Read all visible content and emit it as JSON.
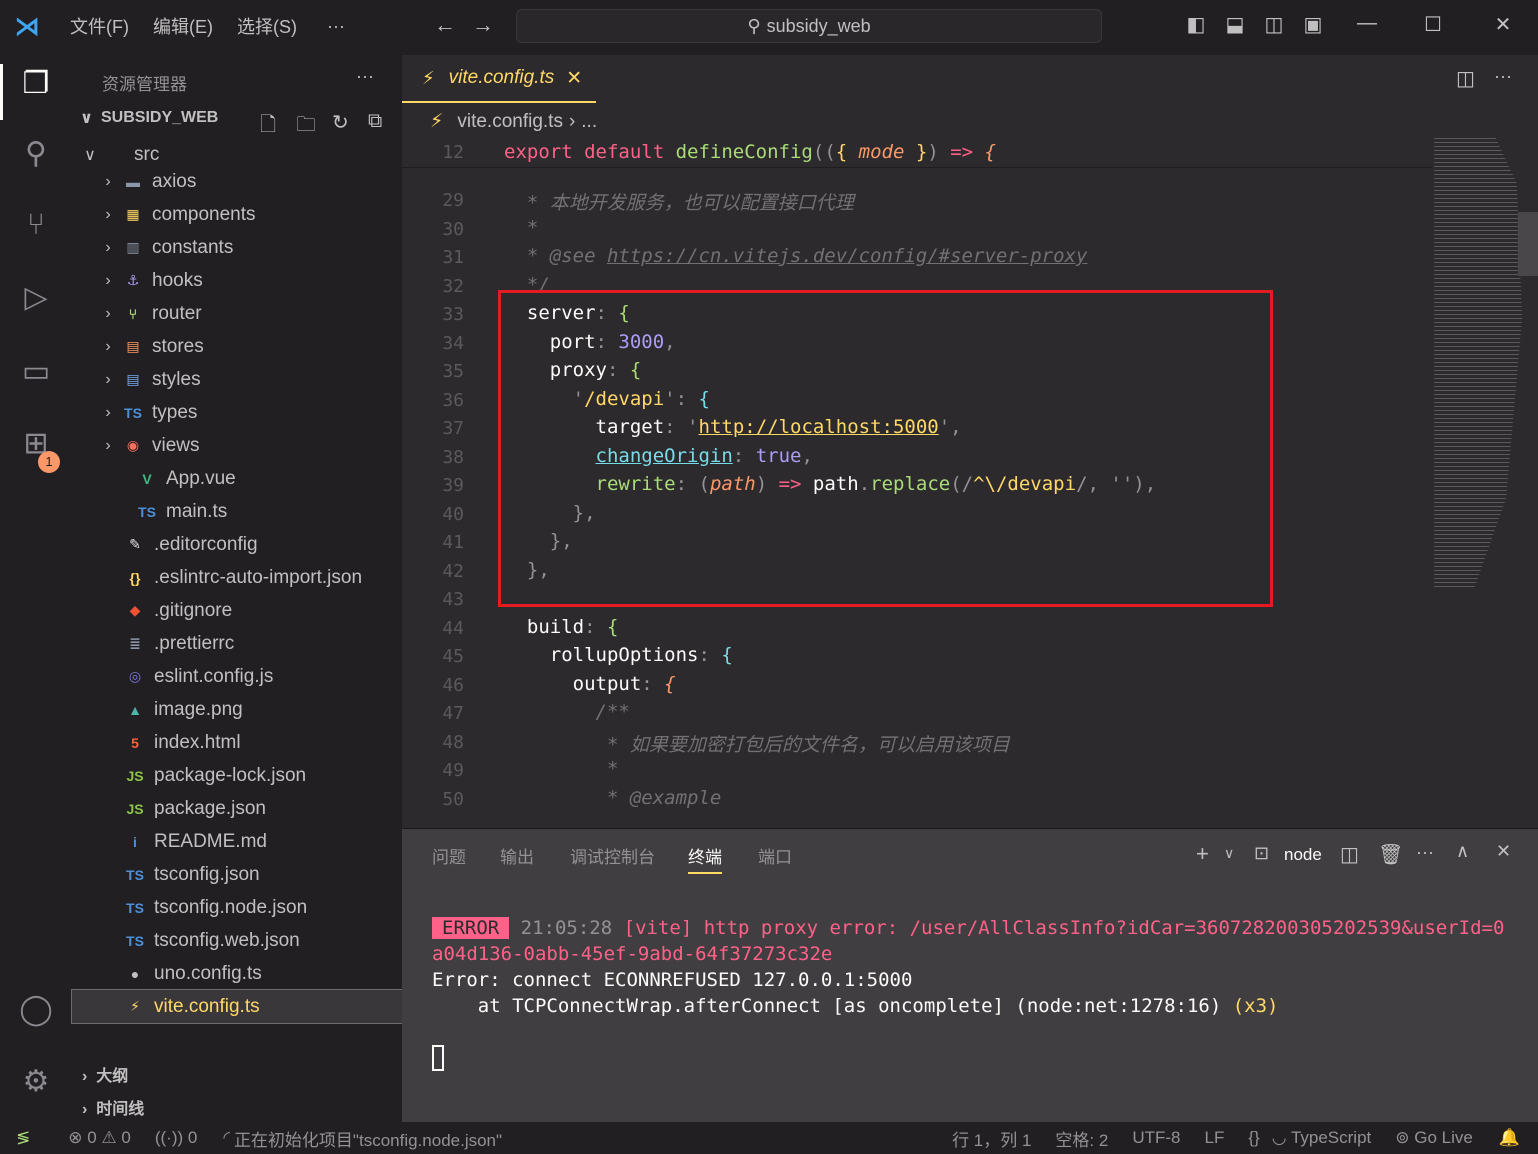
{
  "titlebar": {
    "menus": [
      "文件(F)",
      "编辑(E)",
      "选择(S)",
      "···"
    ],
    "search": "subsidy_web"
  },
  "activity": {
    "badge": "1"
  },
  "sidebar": {
    "title": "资源管理器",
    "more": "···",
    "root": "SUBSIDY_WEB",
    "items": [
      {
        "label": "src",
        "depth": 1,
        "type": "folder-open",
        "icon": "</>",
        "color": "#a9dc76"
      },
      {
        "label": "axios",
        "depth": 2,
        "type": "folder",
        "icon": "▬",
        "color": "#8b96a8"
      },
      {
        "label": "components",
        "depth": 2,
        "type": "folder",
        "icon": "▦",
        "color": "#ffd866"
      },
      {
        "label": "constants",
        "depth": 2,
        "type": "folder",
        "icon": "▥",
        "color": "#8b96a8"
      },
      {
        "label": "hooks",
        "depth": 2,
        "type": "folder",
        "icon": "⚓",
        "color": "#ab9df2"
      },
      {
        "label": "router",
        "depth": 2,
        "type": "folder",
        "icon": "⑂",
        "color": "#a9dc76"
      },
      {
        "label": "stores",
        "depth": 2,
        "type": "folder",
        "icon": "▤",
        "color": "#fc9867"
      },
      {
        "label": "styles",
        "depth": 2,
        "type": "folder",
        "icon": "▤",
        "color": "#78a9e8"
      },
      {
        "label": "types",
        "depth": 2,
        "type": "folder",
        "icon": "TS",
        "color": "#4d8fd8"
      },
      {
        "label": "views",
        "depth": 2,
        "type": "folder",
        "icon": "◉",
        "color": "#fc6d5b"
      },
      {
        "label": "App.vue",
        "depth": 2,
        "type": "file",
        "icon": "V",
        "color": "#41b883"
      },
      {
        "label": "main.ts",
        "depth": 2,
        "type": "file",
        "icon": "TS",
        "color": "#4d8fd8"
      },
      {
        "label": ".editorconfig",
        "depth": 1,
        "type": "file",
        "icon": "✎",
        "color": "#e0e0e0"
      },
      {
        "label": ".eslintrc-auto-import.json",
        "depth": 1,
        "type": "file",
        "icon": "{}",
        "color": "#ffd866"
      },
      {
        "label": ".gitignore",
        "depth": 1,
        "type": "file",
        "icon": "◆",
        "color": "#f05133"
      },
      {
        "label": ".prettierrc",
        "depth": 1,
        "type": "file",
        "icon": "≣",
        "color": "#8b96a8"
      },
      {
        "label": "eslint.config.js",
        "depth": 1,
        "type": "file",
        "icon": "◎",
        "color": "#7e7ae0"
      },
      {
        "label": "image.png",
        "depth": 1,
        "type": "file",
        "icon": "▲",
        "color": "#4db6ac"
      },
      {
        "label": "index.html",
        "depth": 1,
        "type": "file",
        "icon": "5",
        "color": "#f4643b"
      },
      {
        "label": "package-lock.json",
        "depth": 1,
        "type": "file",
        "icon": "JS",
        "color": "#8bc34a"
      },
      {
        "label": "package.json",
        "depth": 1,
        "type": "file",
        "icon": "JS",
        "color": "#8bc34a"
      },
      {
        "label": "README.md",
        "depth": 1,
        "type": "file",
        "icon": "i",
        "color": "#4d8fd8"
      },
      {
        "label": "tsconfig.json",
        "depth": 1,
        "type": "file",
        "icon": "TS",
        "color": "#4d8fd8"
      },
      {
        "label": "tsconfig.node.json",
        "depth": 1,
        "type": "file",
        "icon": "TS",
        "color": "#4d8fd8"
      },
      {
        "label": "tsconfig.web.json",
        "depth": 1,
        "type": "file",
        "icon": "TS",
        "color": "#4d8fd8"
      },
      {
        "label": "uno.config.ts",
        "depth": 1,
        "type": "file",
        "icon": "●",
        "color": "#c1c0c0"
      },
      {
        "label": "vite.config.ts",
        "depth": 1,
        "type": "file",
        "icon": "⚡",
        "color": "#ffd866",
        "selected": true
      }
    ],
    "outline": "大纲",
    "timeline": "时间线"
  },
  "editor": {
    "tab": "vite.config.ts",
    "breadcrumb": "vite.config.ts",
    "breadcrumb_more": "...",
    "sticky": {
      "n": "12",
      "tokens": [
        [
          "export ",
          "kw"
        ],
        [
          "default ",
          "kw"
        ],
        [
          "defineConfig",
          "fn"
        ],
        [
          "((",
          "pu"
        ],
        [
          "{ ",
          "br"
        ],
        [
          "mode",
          "pa"
        ],
        [
          " }",
          "br"
        ],
        [
          ") ",
          "pu"
        ],
        [
          "=> ",
          "kw"
        ],
        [
          "{",
          "pa"
        ]
      ]
    },
    "lines": [
      {
        "n": "29",
        "tokens": [
          [
            "  * 本地开发服务，也可以配置接口代理",
            "cm"
          ]
        ]
      },
      {
        "n": "30",
        "tokens": [
          [
            "  *",
            "cm"
          ]
        ]
      },
      {
        "n": "31",
        "tokens": [
          [
            "  * @see ",
            "cm"
          ],
          [
            "https://cn.vitejs.dev/config/#server-proxy",
            "cm ul"
          ]
        ]
      },
      {
        "n": "32",
        "tokens": [
          [
            "  */",
            "cm"
          ]
        ]
      },
      {
        "n": "33",
        "tokens": [
          [
            "  server",
            "pr"
          ],
          [
            ": ",
            "pu"
          ],
          [
            "{",
            "fn"
          ]
        ]
      },
      {
        "n": "34",
        "tokens": [
          [
            "    port",
            "pr"
          ],
          [
            ": ",
            "pu"
          ],
          [
            "3000",
            "nu"
          ],
          [
            ",",
            "pu"
          ]
        ]
      },
      {
        "n": "35",
        "tokens": [
          [
            "    proxy",
            "pr"
          ],
          [
            ": ",
            "pu"
          ],
          [
            "{",
            "fn"
          ]
        ]
      },
      {
        "n": "36",
        "tokens": [
          [
            "      '",
            "pu"
          ],
          [
            "/devapi",
            "st"
          ],
          [
            "'",
            "pu"
          ],
          [
            ": ",
            "pu"
          ],
          [
            "{",
            "fa"
          ]
        ]
      },
      {
        "n": "37",
        "tokens": [
          [
            "        target",
            "pr"
          ],
          [
            ": ",
            "pu"
          ],
          [
            "'",
            "pu"
          ],
          [
            "http://localhost:5000",
            "st ul"
          ],
          [
            "'",
            "pu"
          ],
          [
            ",",
            "pu"
          ]
        ]
      },
      {
        "n": "38",
        "tokens": [
          [
            "        ",
            "pr"
          ],
          [
            "changeOrigin",
            "fa ul"
          ],
          [
            ": ",
            "pu"
          ],
          [
            "true",
            "nu"
          ],
          [
            ",",
            "pu"
          ]
        ]
      },
      {
        "n": "39",
        "tokens": [
          [
            "        rewrite",
            "fn"
          ],
          [
            ": ",
            "pu"
          ],
          [
            "(",
            "pu"
          ],
          [
            "path",
            "pa"
          ],
          [
            ") ",
            "pu"
          ],
          [
            "=> ",
            "kw"
          ],
          [
            "path",
            "pr"
          ],
          [
            ".",
            "pu"
          ],
          [
            "replace",
            "fn"
          ],
          [
            "(/",
            "pu"
          ],
          [
            "^\\/devapi",
            "st"
          ],
          [
            "/, ",
            "pu"
          ],
          [
            "''",
            "pu"
          ],
          [
            "),",
            "pu"
          ]
        ]
      },
      {
        "n": "40",
        "tokens": [
          [
            "      },",
            "pu"
          ]
        ]
      },
      {
        "n": "41",
        "tokens": [
          [
            "    },",
            "pu"
          ]
        ]
      },
      {
        "n": "42",
        "tokens": [
          [
            "  },",
            "pu"
          ]
        ]
      },
      {
        "n": "43",
        "tokens": [
          [
            "",
            ""
          ]
        ]
      },
      {
        "n": "44",
        "tokens": [
          [
            "  build",
            "pr"
          ],
          [
            ": ",
            "pu"
          ],
          [
            "{",
            "fn"
          ]
        ]
      },
      {
        "n": "45",
        "tokens": [
          [
            "    rollupOptions",
            "pr"
          ],
          [
            ": ",
            "pu"
          ],
          [
            "{",
            "fa"
          ]
        ]
      },
      {
        "n": "46",
        "tokens": [
          [
            "      output",
            "pr"
          ],
          [
            ": ",
            "pu"
          ],
          [
            "{",
            "pa"
          ]
        ]
      },
      {
        "n": "47",
        "tokens": [
          [
            "        /**",
            "cm"
          ]
        ]
      },
      {
        "n": "48",
        "tokens": [
          [
            "         * 如果要加密打包后的文件名，可以启用该项目",
            "cm"
          ]
        ]
      },
      {
        "n": "49",
        "tokens": [
          [
            "         *",
            "cm"
          ]
        ]
      },
      {
        "n": "50",
        "tokens": [
          [
            "         * @example",
            "cm"
          ]
        ]
      }
    ],
    "partial_top": "28",
    "highlight_color": "#e51b24"
  },
  "panel": {
    "tabs": [
      "问题",
      "输出",
      "调试控制台",
      "终端",
      "端口"
    ],
    "active": 3,
    "terminal_name": "node",
    "error_badge": "ERROR",
    "time": "21:05:28",
    "msg1": "[vite] http proxy error: /user/AllClassInfo?idCar=360728200305202539&userId=0",
    "msg2": "a04d136-0abb-45ef-9abd-64f37273c32e",
    "msg3": "Error: connect ECONNREFUSED 127.0.0.1:5000",
    "msg4": "    at TCPConnectWrap.afterConnect [as oncomplete] (node:net:1278:16) ",
    "msg4b": "(x3)"
  },
  "status": {
    "errors": "0",
    "warnings": "0",
    "ports": "0",
    "progress": "正在初始化项目\"tsconfig.node.json\"",
    "position": "行 1，列 1",
    "spaces": "空格: 2",
    "encoding": "UTF-8",
    "eol": "LF",
    "braces": "{}",
    "language": "TypeScript",
    "golive": "Go Live"
  }
}
